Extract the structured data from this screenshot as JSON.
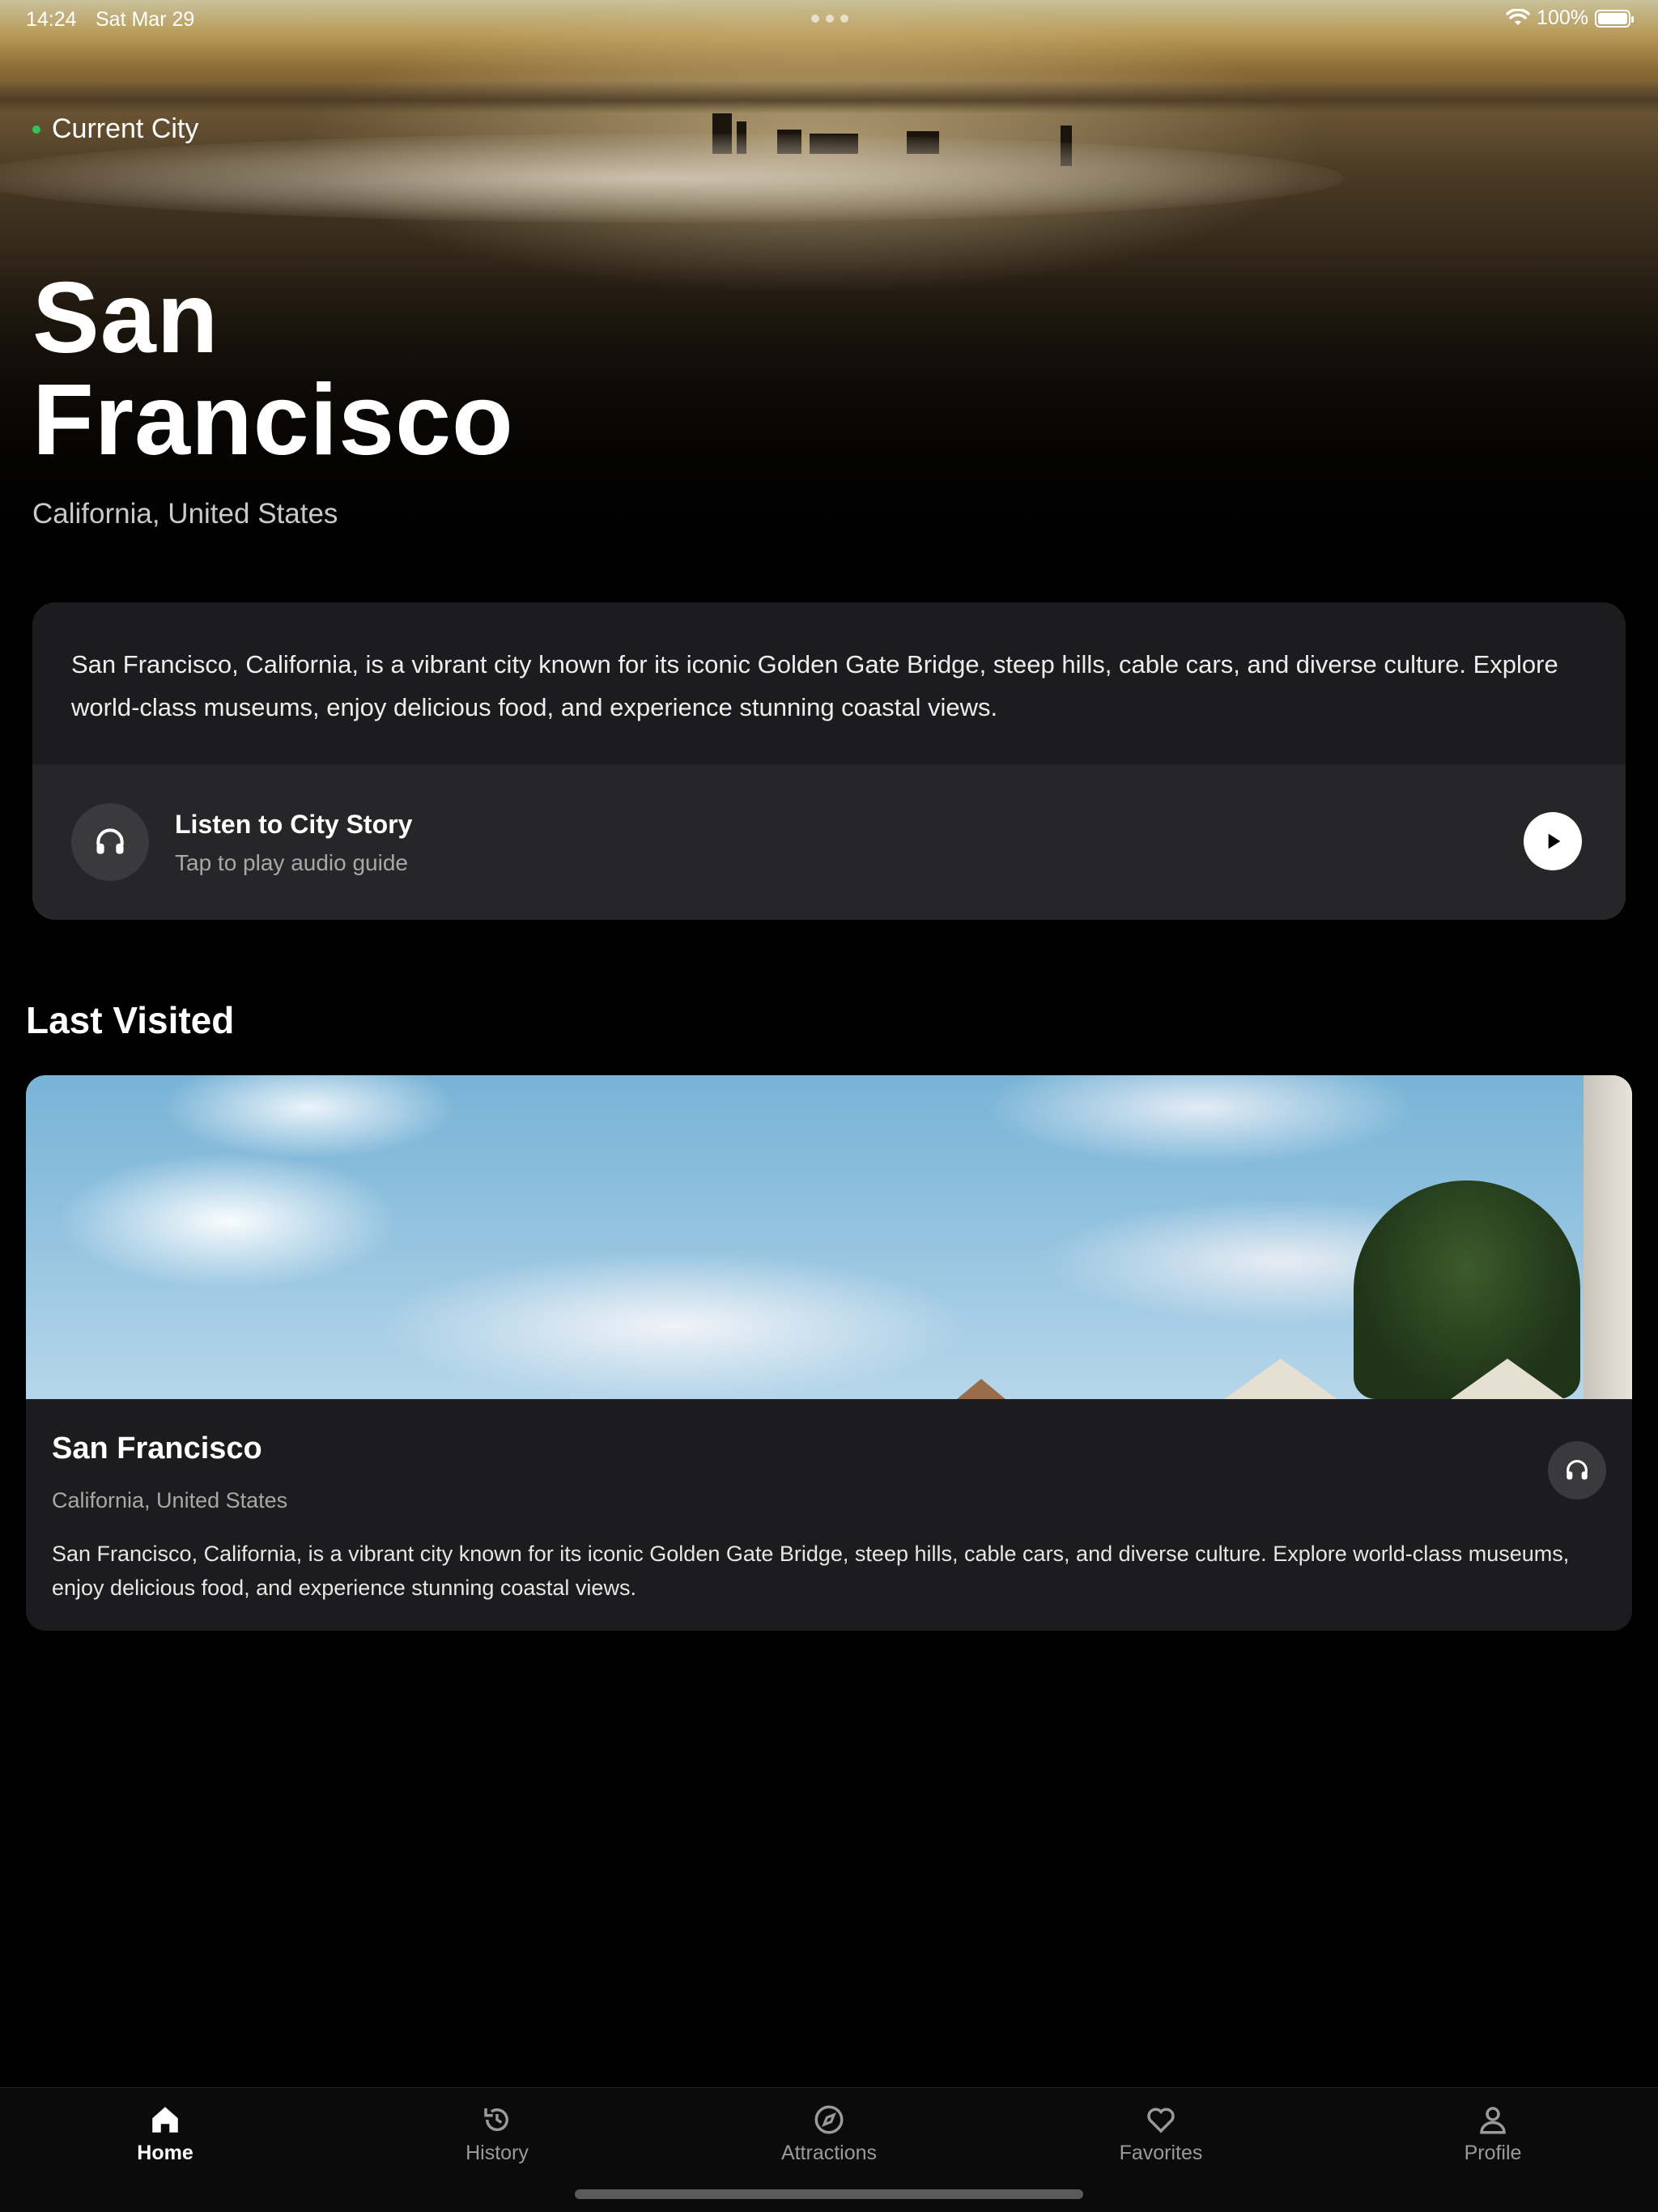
{
  "status": {
    "time": "14:24",
    "date": "Sat Mar 29",
    "battery": "100%"
  },
  "hero": {
    "badge": "Current City",
    "city_line1": "San",
    "city_line2": "Francisco",
    "subtitle": "California, United States"
  },
  "description_card": {
    "text": "San Francisco, California, is a vibrant city known for its iconic Golden Gate Bridge, steep hills, cable cars, and diverse culture. Explore world-class museums, enjoy delicious food, and experience stunning coastal views.",
    "listen_title": "Listen to City Story",
    "listen_subtitle": "Tap to play audio guide"
  },
  "last_visited": {
    "section_title": "Last Visited",
    "items": [
      {
        "name": "San Francisco",
        "location": "California, United States",
        "description": "San Francisco, California, is a vibrant city known for its iconic Golden Gate Bridge, steep hills, cable cars, and diverse culture. Explore world-class museums, enjoy delicious food, and experience stunning coastal views."
      }
    ]
  },
  "tabbar": {
    "tabs": [
      {
        "label": "Home",
        "icon": "home-icon",
        "active": true
      },
      {
        "label": "History",
        "icon": "history-icon",
        "active": false
      },
      {
        "label": "Attractions",
        "icon": "compass-icon",
        "active": false
      },
      {
        "label": "Favorites",
        "icon": "heart-icon",
        "active": false
      },
      {
        "label": "Profile",
        "icon": "person-icon",
        "active": false
      }
    ]
  },
  "colors": {
    "accent_green": "#32c45a",
    "card": "#1c1c1e",
    "background": "#000000"
  }
}
